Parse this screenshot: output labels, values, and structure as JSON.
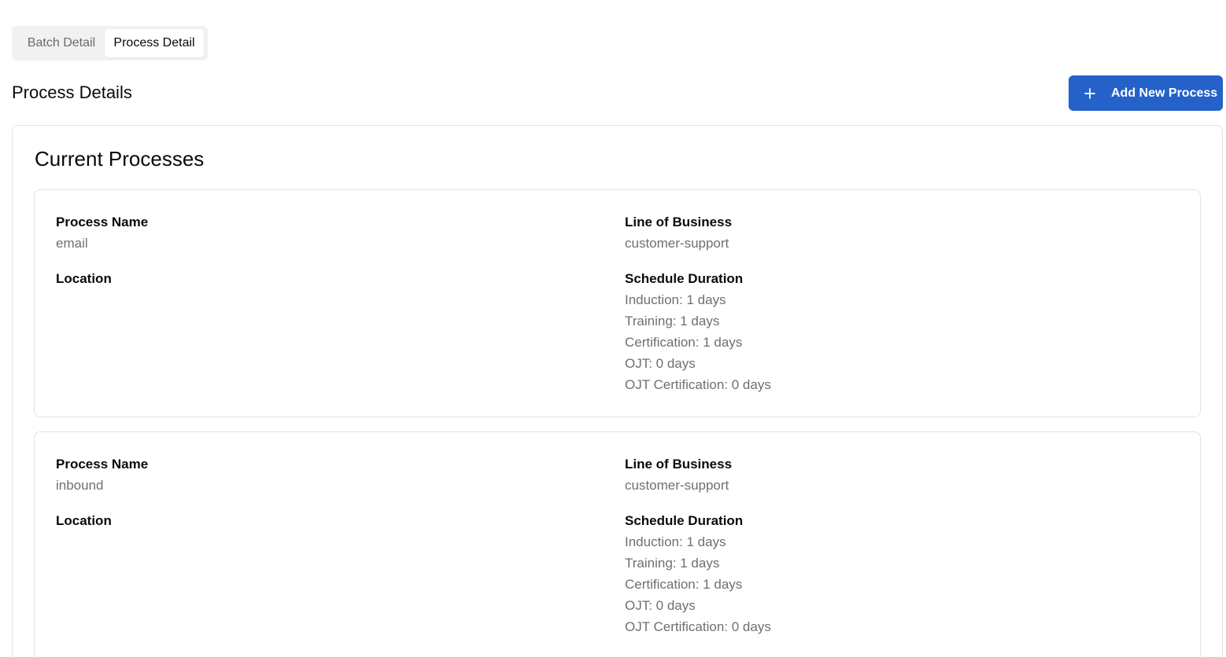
{
  "tabs": [
    {
      "label": "Batch Detail",
      "active": false
    },
    {
      "label": "Process Detail",
      "active": true
    }
  ],
  "header": {
    "title": "Process Details",
    "add_button_label": "Add New Process",
    "add_button_icon": "plus-icon"
  },
  "section": {
    "title": "Current Processes"
  },
  "labels": {
    "process_name": "Process Name",
    "line_of_business": "Line of Business",
    "location": "Location",
    "schedule_duration": "Schedule Duration"
  },
  "processes": [
    {
      "name": "email",
      "line_of_business": "customer-support",
      "location": "",
      "durations": [
        "Induction: 1 days",
        "Training: 1 days",
        "Certification: 1 days",
        "OJT: 0 days",
        "OJT Certification: 0 days"
      ]
    },
    {
      "name": "inbound",
      "line_of_business": "customer-support",
      "location": "",
      "durations": [
        "Induction: 1 days",
        "Training: 1 days",
        "Certification: 1 days",
        "OJT: 0 days",
        "OJT Certification: 0 days"
      ]
    }
  ],
  "colors": {
    "primary": "#2462c9",
    "muted_text": "#6f6f6f",
    "border": "#e3e3e3",
    "tab_bg": "#f1f1f1"
  }
}
